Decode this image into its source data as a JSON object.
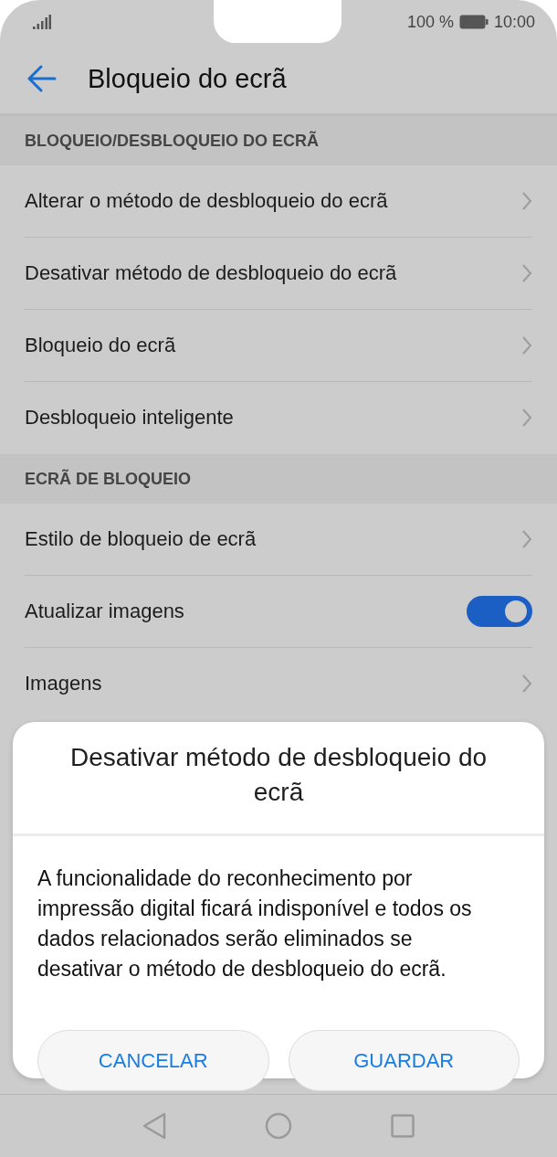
{
  "status_bar": {
    "battery_text": "100 %",
    "time": "10:00"
  },
  "app_bar": {
    "title": "Bloqueio do ecrã"
  },
  "sections": [
    {
      "title": "BLOQUEIO/DESBLOQUEIO DO ECRÃ",
      "items": [
        {
          "label": "Alterar o método de desbloqueio do ecrã",
          "kind": "link"
        },
        {
          "label": "Desativar método de desbloqueio do ecrã",
          "kind": "link"
        },
        {
          "label": "Bloqueio do ecrã",
          "kind": "link"
        },
        {
          "label": "Desbloqueio inteligente",
          "kind": "link"
        }
      ]
    },
    {
      "title": "ECRÃ DE BLOQUEIO",
      "items": [
        {
          "label": "Estilo de bloqueio de ecrã",
          "kind": "link"
        },
        {
          "label": "Atualizar imagens",
          "kind": "toggle",
          "on": true
        },
        {
          "label": "Imagens",
          "kind": "link"
        }
      ]
    }
  ],
  "dialog": {
    "title": "Desativar método de desbloqueio do ecrã",
    "message": "A funcionalidade do reconhecimento por impressão digital ficará indisponível e todos os dados relacionados serão eliminados se desativar o método de desbloqueio do ecrã.",
    "buttons": [
      "CANCELAR",
      "GUARDAR"
    ]
  }
}
